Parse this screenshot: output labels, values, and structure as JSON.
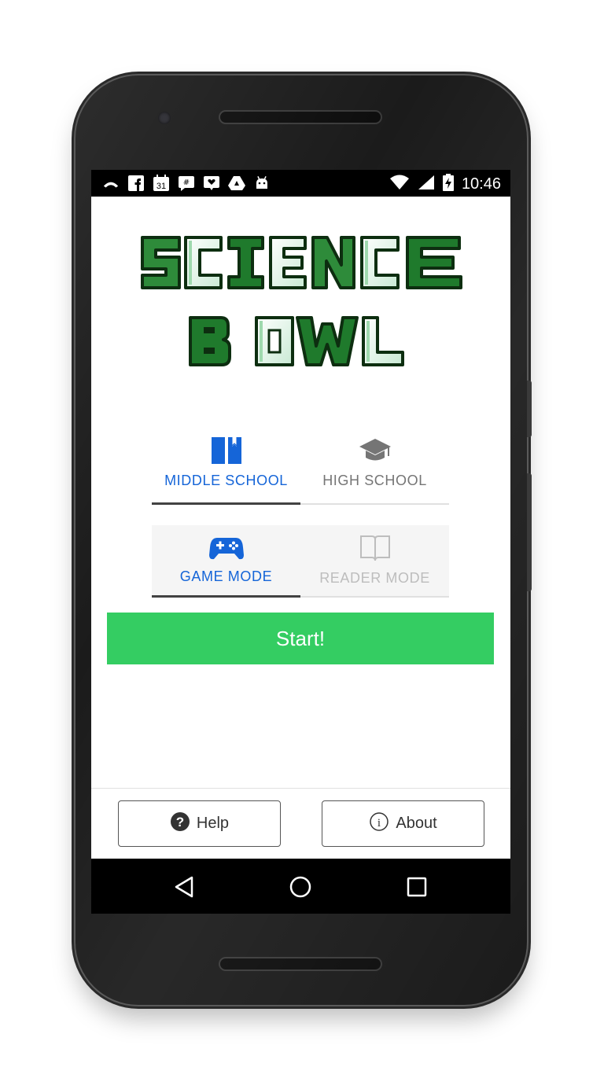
{
  "status_bar": {
    "time": "10:46",
    "calendar_day": "31",
    "left_icons": [
      "missed-call-icon",
      "facebook-icon",
      "calendar-icon",
      "slack-icon",
      "messenger-icon",
      "drive-icon",
      "android-icon"
    ],
    "right_icons": [
      "wifi-icon",
      "signal-icon",
      "battery-charging-icon"
    ]
  },
  "logo": {
    "line1": "SCIENCE",
    "line2": "BOWL",
    "colors": {
      "dark": "#1a5e20",
      "mid": "#2e8b3a",
      "pale": "#dff3e6"
    }
  },
  "level_tabs": [
    {
      "label": "MIDDLE SCHOOL",
      "icon": "book-bookmark-icon",
      "active": true
    },
    {
      "label": "HIGH SCHOOL",
      "icon": "graduation-cap-icon",
      "active": false
    }
  ],
  "mode_tabs": [
    {
      "label": "GAME MODE",
      "icon": "gamepad-icon",
      "active": true
    },
    {
      "label": "READER MODE",
      "icon": "open-book-icon",
      "active": false
    }
  ],
  "start_button": {
    "label": "Start!"
  },
  "footer": {
    "help": {
      "label": "Help",
      "icon": "question-circle-icon"
    },
    "about": {
      "label": "About",
      "icon": "info-circle-icon"
    }
  },
  "nav_bar": [
    "back-icon",
    "home-icon",
    "recents-icon"
  ],
  "colors": {
    "accent_blue": "#1565d8",
    "inactive_gray": "#757575",
    "disabled_gray": "#bdbdbd",
    "start_green": "#34cd62"
  }
}
